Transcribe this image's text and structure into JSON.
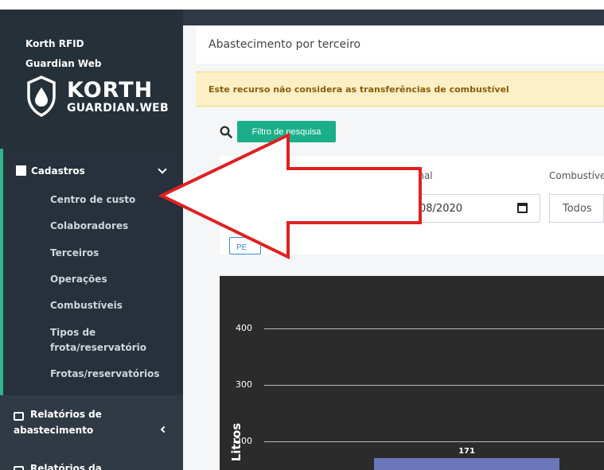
{
  "sidebar": {
    "brand_line1": "Korth RFID",
    "brand_line2": "Guardian Web",
    "logo_title": "KORTH",
    "logo_subtitle": "GUARDIAN.WEB",
    "group_label": "Cadastros",
    "items": [
      {
        "label": "Centro de custo"
      },
      {
        "label": "Colaboradores"
      },
      {
        "label": "Terceiros"
      },
      {
        "label": "Operações"
      },
      {
        "label": "Combustíveis"
      },
      {
        "label": "Tipos de"
      },
      {
        "label": "frota/reservatório"
      },
      {
        "label": "Frotas/reservatórios"
      }
    ],
    "relatorios_label_1": "Relatórios de",
    "relatorios_label_2": "abastecimento",
    "relatorios_da_label": "Relatórios da"
  },
  "main": {
    "page_title": "Abastecimento por terceiro",
    "alert_text": "Este recurso não considera as transferências de combustível",
    "filter_button": "Filtro de pesquisa",
    "label_data_final": "inal",
    "label_combustivel": "Combustíve",
    "date_value": "08/2020",
    "select_value": "Todos",
    "search_button": "PE"
  },
  "colors": {
    "sidebar": "#2f3a45",
    "accent": "#2fb58a",
    "filter_button": "#1aaf88",
    "alert_bg": "#fdf0c6",
    "chart_bg": "#2b2b2b",
    "bar": "#6b76b8",
    "arrow": "#e02020"
  },
  "chart_data": {
    "type": "bar",
    "title": "",
    "ylabel": "Litros",
    "y_ticks": [
      "400",
      "300",
      "200"
    ],
    "ylim": [
      150,
      450
    ],
    "categories": [
      ""
    ],
    "values": [
      171
    ],
    "value_labels": [
      "171"
    ]
  }
}
